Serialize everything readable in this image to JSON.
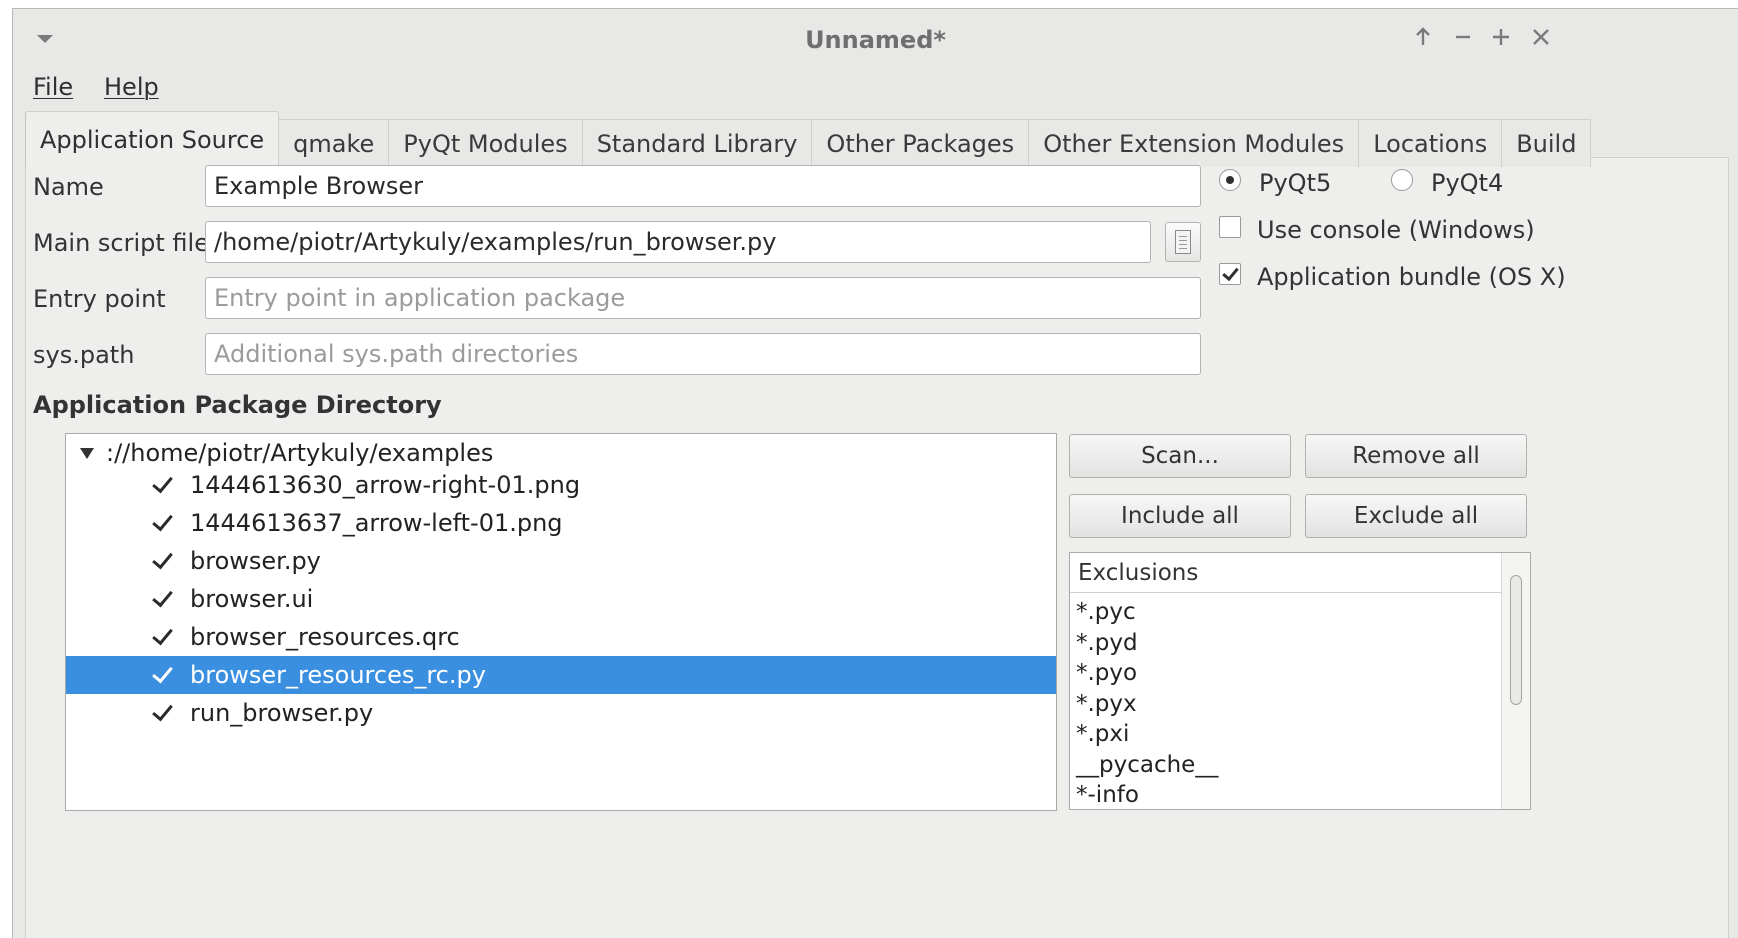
{
  "window": {
    "title": "Unnamed*"
  },
  "menu": {
    "file": "File",
    "help": "Help"
  },
  "tabs": [
    {
      "label": "Application Source",
      "active": true
    },
    {
      "label": "qmake"
    },
    {
      "label": "PyQt Modules"
    },
    {
      "label": "Standard Library"
    },
    {
      "label": "Other Packages"
    },
    {
      "label": "Other Extension Modules"
    },
    {
      "label": "Locations"
    },
    {
      "label": "Build"
    }
  ],
  "form": {
    "name_label": "Name",
    "name_value": "Example Browser",
    "main_script_label": "Main script file",
    "main_script_value": "/home/piotr/Artykuly/examples/run_browser.py",
    "entry_point_label": "Entry point",
    "entry_point_placeholder": "Entry point in application package",
    "syspath_label": "sys.path",
    "syspath_placeholder": "Additional sys.path directories"
  },
  "options": {
    "pyqt5_label": "PyQt5",
    "pyqt5_selected": true,
    "pyqt4_label": "PyQt4",
    "use_console_label": "Use console (Windows)",
    "use_console_checked": false,
    "app_bundle_label": "Application bundle (OS X)",
    "app_bundle_checked": true
  },
  "package_dir": {
    "heading": "Application Package Directory",
    "root": "://home/piotr/Artykuly/examples",
    "files": [
      "1444613630_arrow-right-01.png",
      "1444613637_arrow-left-01.png",
      "browser.py",
      "browser.ui",
      "browser_resources.qrc",
      "browser_resources_rc.py",
      "run_browser.py"
    ],
    "selected_index": 5
  },
  "buttons": {
    "scan": "Scan...",
    "remove_all": "Remove all",
    "include_all": "Include all",
    "exclude_all": "Exclude all"
  },
  "exclusions": {
    "header": "Exclusions",
    "items": [
      "*.pyc",
      "*.pyd",
      "*.pyo",
      "*.pyx",
      "*.pxi",
      "__pycache__",
      "*-info"
    ]
  }
}
